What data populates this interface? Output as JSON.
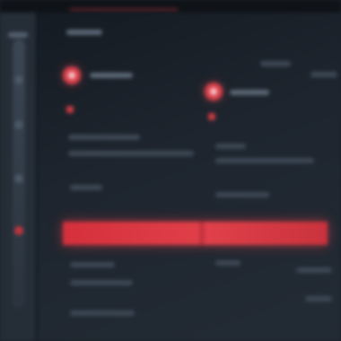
{
  "window": {
    "title": "",
    "accent_color": "#e0404a",
    "background_color": "#1c222b"
  },
  "sidebar": {
    "items": [
      {
        "icon": "home-icon",
        "active": false
      },
      {
        "icon": "list-icon",
        "active": false
      },
      {
        "icon": "settings-icon",
        "active": false
      },
      {
        "icon": "alert-icon",
        "active": true
      }
    ]
  },
  "panes": {
    "left": {
      "badge_icon": "record-icon",
      "flag_icon": "flag-icon"
    },
    "right": {
      "badge_icon": "record-icon",
      "flag_icon": "flag-icon"
    }
  },
  "selection": {
    "row_color": "#d5303c"
  }
}
